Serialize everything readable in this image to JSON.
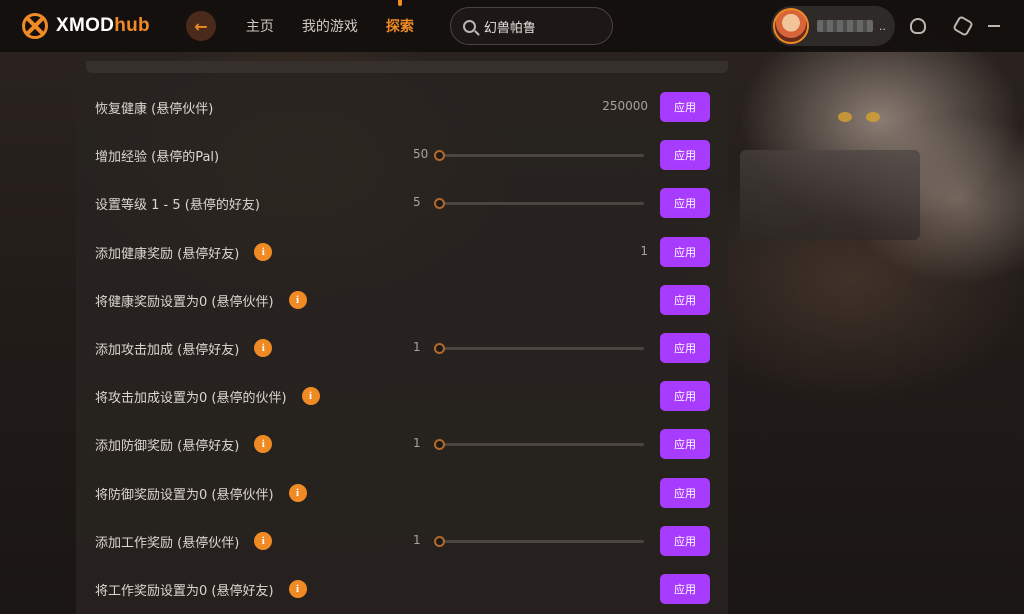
{
  "header": {
    "logo_main": "XMOD",
    "logo_accent": "hub",
    "nav": [
      {
        "label": "主页",
        "active": false
      },
      {
        "label": "我的游戏",
        "active": false
      },
      {
        "label": "探索",
        "active": true
      }
    ],
    "search_value": "幻兽帕鲁",
    "user_more": "..",
    "accent_color": "#f08a24"
  },
  "apply_label": "应用",
  "apply_color": "#a73cff",
  "rows": [
    {
      "label": "恢复健康 (悬停伙伴)",
      "info": false,
      "value": "250000",
      "control": "number"
    },
    {
      "label": "增加经验 (悬停的Pal)",
      "info": false,
      "value": "50",
      "control": "slider",
      "level": 0.0
    },
    {
      "label": "设置等级 1 - 5 (悬停的好友)",
      "info": false,
      "value": "5",
      "control": "slider",
      "level": 0.0
    },
    {
      "label": "添加健康奖励 (悬停好友)",
      "info": true,
      "value": "1",
      "control": "number"
    },
    {
      "label": "将健康奖励设置为0 (悬停伙伴)",
      "info": true,
      "value": "",
      "control": "none"
    },
    {
      "label": "添加攻击加成 (悬停好友)",
      "info": true,
      "value": "1",
      "control": "slider",
      "level": 0.0
    },
    {
      "label": "将攻击加成设置为0 (悬停的伙伴)",
      "info": true,
      "value": "",
      "control": "none"
    },
    {
      "label": "添加防御奖励 (悬停好友)",
      "info": true,
      "value": "1",
      "control": "slider",
      "level": 0.0
    },
    {
      "label": "将防御奖励设置为0 (悬停伙伴)",
      "info": true,
      "value": "",
      "control": "none"
    },
    {
      "label": "添加工作奖励 (悬停伙伴)",
      "info": true,
      "value": "1",
      "control": "slider",
      "level": 0.0
    },
    {
      "label": "将工作奖励设置为0 (悬停好友)",
      "info": true,
      "value": "",
      "control": "none"
    }
  ],
  "info_glyph": "i"
}
